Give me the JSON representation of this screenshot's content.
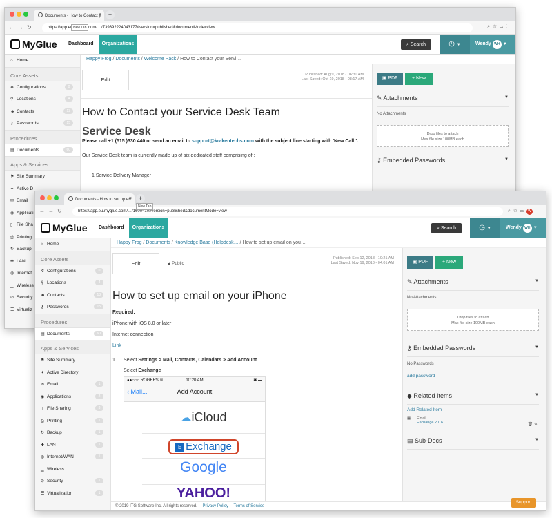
{
  "win1": {
    "tab_title": "Documents - How to Contact y",
    "url": "https://app.eu.myglue.com/…/739392224043177#version=published&documentMode=view",
    "new_tab_tip": "New Tab",
    "app": {
      "logo": "MyGlue",
      "nav_dashboard": "Dashboard",
      "nav_orgs": "Organizations",
      "search": "Search",
      "user": "Wendy",
      "user_initials": "WH"
    },
    "sidebar": {
      "home": "Home",
      "core_assets": "Core Assets",
      "core": [
        {
          "label": "Configurations",
          "count": "0"
        },
        {
          "label": "Locations",
          "count": "4"
        },
        {
          "label": "Contacts",
          "count": "13"
        },
        {
          "label": "Passwords",
          "count": "15"
        }
      ],
      "procedures": "Procedures",
      "documents": "Documents",
      "documents_count": "60",
      "apps_services": "Apps & Services",
      "apps": [
        "Site Summary",
        "Active D",
        "Email",
        "Applicati",
        "File Sha",
        "Printing",
        "Backup",
        "LAN",
        "Internet",
        "Wireless",
        "Security",
        "Virtualiz"
      ]
    },
    "breadcrumb": {
      "b1": "Happy Frog",
      "b2": "Documents",
      "b3": "Welcome Pack",
      "current": "How to Contact your Servi…"
    },
    "doc": {
      "edit": "Edit",
      "published": "Published: Aug 9, 2018 - 06:30 AM",
      "last_saved": "Last Saved: Oct 19, 2018 - 08:17 AM",
      "title": "How to Contact your Service Desk Team",
      "h2": "Service Desk",
      "call_pre": "Please call +1 (515 )330 440 or send an email to ",
      "email": "support@krakentechs.com",
      "call_post": " with the subject line starting with 'New Call:'.",
      "team": "Our Service Desk team is currently made up of six dedicated staff comprising of :",
      "item1": "1 Service Delivery Manager"
    },
    "right": {
      "pdf": "PDF",
      "new": "New",
      "attachments": "Attachments",
      "no_attachments": "No Attachments",
      "drop1": "Drop files to attach",
      "drop2": "Max file size 100MB each",
      "embedded": "Embedded Passwords"
    }
  },
  "win2": {
    "tab_title": "Documents - How to set up en",
    "url": "https://app.eu.myglue.com/…/1600410#version=published&documentMode=view",
    "new_tab_tip": "New Tab",
    "app": {
      "logo": "MyGlue",
      "nav_dashboard": "Dashboard",
      "nav_orgs": "Organizations",
      "search": "Search",
      "user": "Wendy",
      "user_initials": "WH"
    },
    "sidebar": {
      "home": "Home",
      "core_assets": "Core Assets",
      "core": [
        {
          "label": "Configurations",
          "count": "0"
        },
        {
          "label": "Locations",
          "count": "4"
        },
        {
          "label": "Contacts",
          "count": "13"
        },
        {
          "label": "Passwords",
          "count": "15"
        }
      ],
      "procedures": "Procedures",
      "documents": "Documents",
      "documents_count": "60",
      "apps_services": "Apps & Services",
      "apps": [
        {
          "label": "Site Summary",
          "count": ""
        },
        {
          "label": "Active Directory",
          "count": ""
        },
        {
          "label": "Email",
          "count": "1"
        },
        {
          "label": "Applications",
          "count": "2"
        },
        {
          "label": "File Sharing",
          "count": "3"
        },
        {
          "label": "Printing",
          "count": "1"
        },
        {
          "label": "Backup",
          "count": "1"
        },
        {
          "label": "LAN",
          "count": "1"
        },
        {
          "label": "Internet/WAN",
          "count": "1"
        },
        {
          "label": "Wireless",
          "count": ""
        },
        {
          "label": "Security",
          "count": "1"
        },
        {
          "label": "Virtualization",
          "count": "1"
        }
      ]
    },
    "breadcrumb": {
      "b1": "Happy Frog",
      "b2": "Documents",
      "b3": "Knowledge Base (Helpdesk…",
      "current": "How to set up email on you…"
    },
    "doc": {
      "edit": "Edit",
      "public": "Public",
      "published": "Published: Sep 12, 2018 - 10:21 AM",
      "last_saved": "Last Saved: Nov 19, 2018 - 04:01 AM",
      "title": "How to set up email on your iPhone",
      "required": "Required:",
      "req1": "iPhone with iOS 8.0 or later",
      "req2": "Internet connection",
      "link": "Link",
      "step_num": "1.",
      "step_pre": "Select ",
      "step_bold": "Settings > Mail, Contacts, Calendars > Add Account",
      "select_exchange_pre": "Select ",
      "select_exchange_bold": "Exchange",
      "iphone": {
        "carrier": "●●○○○ ROGERS",
        "time": "10:20 AM",
        "back": "Mail...",
        "title": "Add Account",
        "icloud": "iCloud",
        "exchange": "Exchange",
        "google": "Google",
        "yahoo": "YAHOO!"
      }
    },
    "right": {
      "pdf": "PDF",
      "new": "New",
      "attachments": "Attachments",
      "no_attachments": "No Attachments",
      "drop1": "Drop files to attach",
      "drop2": "Max file size 100MB each",
      "embedded": "Embedded Passwords",
      "no_passwords": "No Passwords",
      "add_password": "add password",
      "related": "Related Items",
      "add_related": "Add Related Item",
      "rel_type": "Email",
      "rel_name": "Exchange 2016",
      "subdocs": "Sub-Docs"
    },
    "footer": {
      "copyright": "© 2019 ITG Software Inc. All rights reserved.",
      "privacy": "Privacy Policy",
      "terms": "Terms of Service",
      "support": "Support"
    }
  },
  "colors": {
    "teal": "#2ba8a0",
    "dark_teal": "#3d8790",
    "green": "#2ba87a",
    "link": "#2b7b9e",
    "support": "#e8952a"
  }
}
